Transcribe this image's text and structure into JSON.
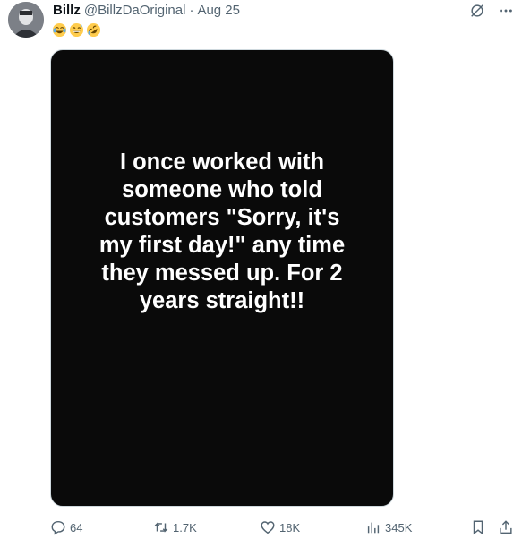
{
  "tweet": {
    "display_name": "Billz",
    "handle": "@BillzDaOriginal",
    "separator": "·",
    "date": "Aug 25",
    "emojis": [
      "face-with-tears-of-joy-icon",
      "grinning-sweat-icon",
      "rolling-on-floor-laughing-icon"
    ],
    "media_text": "I once worked with\nsomeone who told\ncustomers \"Sorry, it's\nmy first day!\" any time\nthey messed up. For 2\nyears straight!!",
    "media_background": "#0a0a0a"
  },
  "top_icons": [
    "grok-icon",
    "more-icon"
  ],
  "actions": {
    "reply": {
      "icon": "reply-icon",
      "count": "64"
    },
    "retweet": {
      "icon": "retweet-icon",
      "count": "1.7K"
    },
    "like": {
      "icon": "heart-icon",
      "count": "18K"
    },
    "views": {
      "icon": "views-icon",
      "count": "345K"
    },
    "bookmark": {
      "icon": "bookmark-icon"
    },
    "share": {
      "icon": "share-icon"
    }
  },
  "colors": {
    "text_primary": "#0f1419",
    "text_secondary": "#536471",
    "border": "#cfd9de"
  }
}
